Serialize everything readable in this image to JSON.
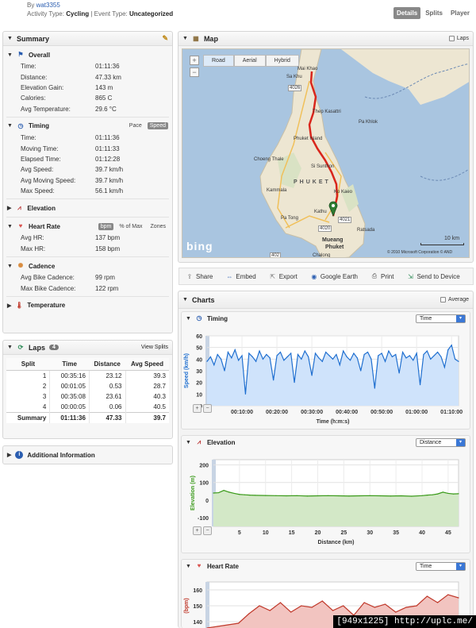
{
  "header": {
    "by_prefix": "By",
    "user": "wat3355",
    "activity_label": "Activity Type:",
    "activity_value": "Cycling",
    "event_label": "| Event Type:",
    "event_value": "Uncategorized",
    "tabs": [
      "Details",
      "Splits",
      "Player"
    ]
  },
  "summary": {
    "title": "Summary",
    "overall": {
      "title": "Overall",
      "rows": [
        {
          "k": "Time:",
          "v": "01:11:36"
        },
        {
          "k": "Distance:",
          "v": "47.33 km"
        },
        {
          "k": "Elevation Gain:",
          "v": "143 m"
        },
        {
          "k": "Calories:",
          "v": "865 C"
        },
        {
          "k": "Avg Temperature:",
          "v": "29.6 °C"
        }
      ]
    },
    "timing": {
      "title": "Timing",
      "toggle": [
        "Pace",
        "Speed"
      ],
      "rows": [
        {
          "k": "Time:",
          "v": "01:11:36"
        },
        {
          "k": "Moving Time:",
          "v": "01:11:33"
        },
        {
          "k": "Elapsed Time:",
          "v": "01:12:28"
        },
        {
          "k": "Avg Speed:",
          "v": "39.7 km/h"
        },
        {
          "k": "Avg Moving Speed:",
          "v": "39.7 km/h"
        },
        {
          "k": "Max Speed:",
          "v": "56.1 km/h"
        }
      ]
    },
    "elevation": {
      "title": "Elevation"
    },
    "heart_rate": {
      "title": "Heart Rate",
      "toggle": [
        "bpm",
        "% of Max",
        "Zones"
      ],
      "rows": [
        {
          "k": "Avg HR:",
          "v": "137 bpm"
        },
        {
          "k": "Max HR:",
          "v": "158 bpm"
        }
      ]
    },
    "cadence": {
      "title": "Cadence",
      "rows": [
        {
          "k": "Avg Bike Cadence:",
          "v": "99 rpm"
        },
        {
          "k": "Max Bike Cadence:",
          "v": "122 rpm"
        }
      ]
    },
    "temperature": {
      "title": "Temperature"
    }
  },
  "laps": {
    "title": "Laps",
    "count": "4",
    "view_splits": "View Splits",
    "columns": [
      "Split",
      "Time",
      "Distance",
      "Avg Speed"
    ],
    "rows": [
      [
        "1",
        "00:35:16",
        "23.12",
        "39.3"
      ],
      [
        "2",
        "00:01:05",
        "0.53",
        "28.7"
      ],
      [
        "3",
        "00:35:08",
        "23.61",
        "40.3"
      ],
      [
        "4",
        "00:00:05",
        "0.06",
        "40.5"
      ]
    ],
    "summary_row": [
      "Summary",
      "01:11:36",
      "47.33",
      "39.7"
    ]
  },
  "additional": {
    "title": "Additional Information"
  },
  "map": {
    "title": "Map",
    "laps_label": "Laps",
    "types": [
      "Road",
      "Aerial",
      "Hybrid"
    ],
    "labels": {
      "mai_khao": "Mai Khao",
      "sa_khu": "Sa Khu",
      "thep_kasattri": "Thep Kasattri",
      "pa_khlok": "Pa Khlok",
      "phuket_island": "Phuket Island",
      "choeng_thale": "Choeng Thale",
      "si_sunthon": "Si Sunthon",
      "phuket": "PHUKET",
      "kammala": "Kammala",
      "ko_kaeo": "Ko Kaeo",
      "pa_tong": "Pa Tong",
      "kathu": "Kathu",
      "ratsada": "Ratsada",
      "mueang": "Mueang",
      "phuket_city": "Phuket",
      "chalong": "Chalong",
      "road_4026": "4026",
      "road_4020": "4020",
      "road_4021": "4021",
      "road_402": "402",
      "scale": "10 km",
      "bing": "bing",
      "copyright": "© 2010 Microsoft Corporation  © AND"
    }
  },
  "actions": [
    {
      "icon": "share-icon",
      "label": "Share"
    },
    {
      "icon": "embed-icon",
      "label": "Embed"
    },
    {
      "icon": "export-icon",
      "label": "Export"
    },
    {
      "icon": "google-earth-icon",
      "label": "Google Earth"
    },
    {
      "icon": "print-icon",
      "label": "Print"
    },
    {
      "icon": "send-device-icon",
      "label": "Send to Device"
    }
  ],
  "charts": {
    "title": "Charts",
    "average_label": "Average",
    "timing": {
      "title": "Timing",
      "select": "Time"
    },
    "elevation": {
      "title": "Elevation",
      "select": "Distance"
    },
    "heart_rate": {
      "title": "Heart Rate",
      "select": "Time"
    }
  },
  "chart_data": [
    {
      "type": "line",
      "title": "Timing",
      "xlabel": "Time (h:m:s)",
      "ylabel": "Speed (km/h)",
      "xlim": [
        0,
        72
      ],
      "ylim": [
        0,
        60
      ],
      "yticks": [
        0,
        10,
        20,
        30,
        40,
        50,
        60
      ],
      "xticks": [
        {
          "v": 10,
          "label": "00:10:00"
        },
        {
          "v": 20,
          "label": "00:20:00"
        },
        {
          "v": 30,
          "label": "00:30:00"
        },
        {
          "v": 40,
          "label": "00:40:00"
        },
        {
          "v": 50,
          "label": "00:50:00"
        },
        {
          "v": 60,
          "label": "01:00:00"
        },
        {
          "v": 70,
          "label": "01:10:00"
        }
      ],
      "color": "#1f6fd0",
      "x": [
        0,
        1,
        2,
        3,
        4,
        5,
        6,
        7,
        8,
        9,
        10,
        11,
        12,
        13,
        14,
        15,
        16,
        17,
        18,
        19,
        20,
        21,
        22,
        23,
        24,
        25,
        26,
        27,
        28,
        29,
        30,
        31,
        32,
        33,
        34,
        35,
        36,
        37,
        38,
        39,
        40,
        41,
        42,
        43,
        44,
        45,
        46,
        47,
        48,
        49,
        50,
        51,
        52,
        53,
        54,
        55,
        56,
        57,
        58,
        59,
        60,
        61,
        62,
        63,
        64,
        65,
        66,
        67,
        68,
        69,
        70,
        71,
        72
      ],
      "values": [
        38,
        42,
        35,
        44,
        40,
        30,
        46,
        41,
        48,
        39,
        43,
        10,
        45,
        42,
        38,
        47,
        40,
        44,
        41,
        22,
        43,
        46,
        39,
        42,
        45,
        20,
        44,
        40,
        47,
        42,
        26,
        45,
        41,
        38,
        46,
        43,
        40,
        44,
        35,
        47,
        42,
        39,
        45,
        41,
        30,
        44,
        46,
        40,
        15,
        43,
        45,
        38,
        47,
        42,
        44,
        28,
        46,
        41,
        43,
        39,
        45,
        18,
        44,
        47,
        40,
        43,
        46,
        42,
        33,
        48,
        52,
        40,
        38
      ]
    },
    {
      "type": "area",
      "title": "Elevation",
      "xlabel": "Distance (km)",
      "ylabel": "Elevation (m)",
      "xlim": [
        0,
        47
      ],
      "ylim": [
        -150,
        230
      ],
      "yticks": [
        -100,
        0,
        100,
        200
      ],
      "xticks": [
        5,
        10,
        15,
        20,
        25,
        30,
        35,
        40,
        45
      ],
      "color": "#3a9a1a",
      "x": [
        0,
        1,
        2,
        3,
        4,
        5,
        6,
        7,
        8,
        10,
        12,
        14,
        16,
        18,
        20,
        22,
        24,
        26,
        28,
        30,
        32,
        34,
        36,
        38,
        40,
        41,
        42,
        43,
        44,
        45,
        46,
        47
      ],
      "values": [
        40,
        42,
        55,
        45,
        38,
        32,
        30,
        28,
        27,
        26,
        25,
        24,
        25,
        23,
        24,
        25,
        24,
        23,
        24,
        25,
        24,
        23,
        24,
        22,
        25,
        28,
        30,
        35,
        45,
        38,
        35,
        36
      ]
    },
    {
      "type": "area",
      "title": "Heart Rate",
      "ylabel": "(bpm)",
      "ylim": [
        135,
        165
      ],
      "yticks": [
        140,
        150,
        160
      ],
      "color": "#c0392b",
      "x": [
        0,
        3,
        6,
        9,
        12,
        15,
        18,
        21,
        24,
        27,
        30,
        33,
        36,
        39,
        42,
        45,
        48,
        51,
        54,
        57,
        60,
        63,
        66,
        69,
        72
      ],
      "values": [
        136,
        137,
        138,
        139,
        145,
        150,
        147,
        152,
        146,
        150,
        149,
        153,
        147,
        150,
        144,
        152,
        149,
        151,
        146,
        149,
        150,
        156,
        152,
        157,
        155
      ]
    }
  ],
  "watermark": "[949x1225] http://uplc.me/"
}
